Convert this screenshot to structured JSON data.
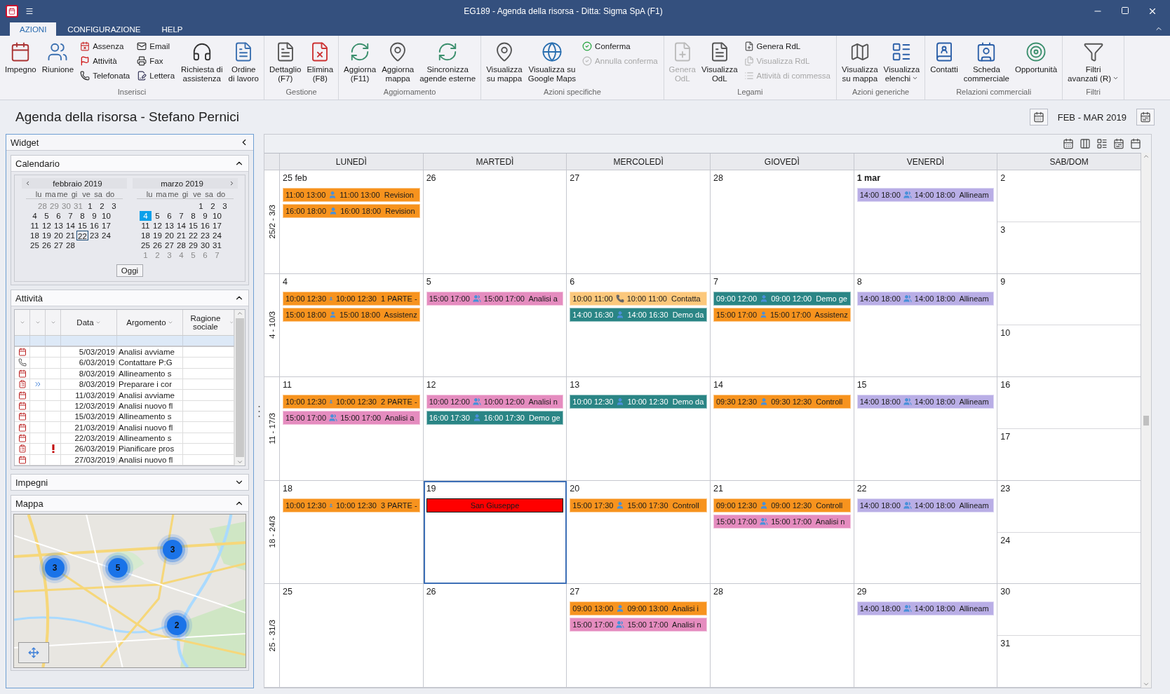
{
  "window": {
    "title": "EG189 - Agenda della risorsa - Ditta: Sigma SpA (F1)"
  },
  "tabs": [
    {
      "label": "AZIONI",
      "selected": true
    },
    {
      "label": "CONFIGURAZIONE",
      "selected": false
    },
    {
      "label": "HELP",
      "selected": false
    }
  ],
  "ribbon": [
    {
      "label": "Inserisci",
      "items": [
        {
          "kind": "large",
          "label": "Impegno",
          "disabled": false
        },
        {
          "kind": "large",
          "label": "Riunione",
          "disabled": false
        },
        {
          "kind": "small",
          "label": "Assenza",
          "disabled": false
        },
        {
          "kind": "small",
          "label": "Attività",
          "disabled": false
        },
        {
          "kind": "small",
          "label": "Telefonata",
          "disabled": false
        },
        {
          "kind": "small",
          "label": "Email",
          "disabled": false
        },
        {
          "kind": "small",
          "label": "Fax",
          "disabled": false
        },
        {
          "kind": "small",
          "label": "Lettera",
          "disabled": false
        },
        {
          "kind": "large",
          "label": "Richiesta di\nassistenza",
          "disabled": false
        },
        {
          "kind": "large",
          "label": "Ordine\ndi lavoro",
          "disabled": false
        }
      ]
    },
    {
      "label": "Gestione",
      "items": [
        {
          "kind": "large",
          "label": "Dettaglio\n(F7)",
          "disabled": false
        },
        {
          "kind": "large",
          "label": "Elimina\n(F8)",
          "disabled": false
        }
      ]
    },
    {
      "label": "Aggiornamento",
      "items": [
        {
          "kind": "large",
          "label": "Aggiorna\n(F11)",
          "disabled": false
        },
        {
          "kind": "large",
          "label": "Aggiorna\nmappa",
          "disabled": false
        },
        {
          "kind": "large",
          "label": "Sincronizza\nagende esterne",
          "disabled": false
        }
      ]
    },
    {
      "label": "Azioni specifiche",
      "items": [
        {
          "kind": "large",
          "label": "Visualizza\nsu mappa",
          "disabled": false
        },
        {
          "kind": "large",
          "label": "Visualizza su\nGoogle Maps",
          "disabled": false
        },
        {
          "kind": "small",
          "label": "Conferma",
          "disabled": false
        },
        {
          "kind": "small",
          "label": "Annulla conferma",
          "disabled": true
        }
      ]
    },
    {
      "label": "Legami",
      "items": [
        {
          "kind": "large",
          "label": "Genera\nOdL",
          "disabled": true
        },
        {
          "kind": "large",
          "label": "Visualizza\nOdL",
          "disabled": false
        },
        {
          "kind": "small",
          "label": "Genera RdL",
          "disabled": false
        },
        {
          "kind": "small",
          "label": "Visualizza RdL",
          "disabled": true
        },
        {
          "kind": "small",
          "label": "Attività di commessa",
          "disabled": true
        }
      ]
    },
    {
      "label": "Azioni generiche",
      "items": [
        {
          "kind": "large",
          "label": "Visualizza\nsu mappa",
          "disabled": false
        },
        {
          "kind": "dropdown",
          "label": "Visualizza\nelenchi",
          "disabled": false
        }
      ]
    },
    {
      "label": "Relazioni commerciali",
      "items": [
        {
          "kind": "large",
          "label": "Contatti",
          "disabled": false
        },
        {
          "kind": "large",
          "label": "Scheda\ncommerciale",
          "disabled": false
        },
        {
          "kind": "large",
          "label": "Opportunità",
          "disabled": false
        }
      ]
    },
    {
      "label": "Filtri",
      "items": [
        {
          "kind": "dropdown",
          "label": "Filtri\navanzati (R)",
          "disabled": false
        }
      ]
    }
  ],
  "page_title": "Agenda della risorsa - Stefano Pernici",
  "period": "FEB - MAR 2019",
  "widget": {
    "title": "Widget",
    "calendar": {
      "title": "Calendario",
      "expanded": true,
      "today_button": "Oggi",
      "months": [
        {
          "title": "febbraio 2019",
          "weekdays": [
            "lu",
            "ma",
            "me",
            "gi",
            "ve",
            "sa",
            "do"
          ],
          "weeks": [
            [
              {
                "d": "28",
                "muted": true,
                "selected": false,
                "today": false
              },
              {
                "d": "29",
                "muted": true,
                "selected": false,
                "today": false
              },
              {
                "d": "30",
                "muted": true,
                "selected": false,
                "today": false
              },
              {
                "d": "31",
                "muted": true,
                "selected": false,
                "today": false
              },
              {
                "d": "1",
                "muted": false,
                "selected": false,
                "today": false
              },
              {
                "d": "2",
                "muted": false,
                "selected": false,
                "today": false
              },
              {
                "d": "3",
                "muted": false,
                "selected": false,
                "today": false
              }
            ],
            [
              {
                "d": "4",
                "muted": false,
                "selected": false,
                "today": false
              },
              {
                "d": "5",
                "muted": false,
                "selected": false,
                "today": false
              },
              {
                "d": "6",
                "muted": false,
                "selected": false,
                "today": false
              },
              {
                "d": "7",
                "muted": false,
                "selected": false,
                "today": false
              },
              {
                "d": "8",
                "muted": false,
                "selected": false,
                "today": false
              },
              {
                "d": "9",
                "muted": false,
                "selected": false,
                "today": false
              },
              {
                "d": "10",
                "muted": false,
                "selected": false,
                "today": false
              }
            ],
            [
              {
                "d": "11",
                "muted": false,
                "selected": false,
                "today": false
              },
              {
                "d": "12",
                "muted": false,
                "selected": false,
                "today": false
              },
              {
                "d": "13",
                "muted": false,
                "selected": false,
                "today": false
              },
              {
                "d": "14",
                "muted": false,
                "selected": false,
                "today": false
              },
              {
                "d": "15",
                "muted": false,
                "selected": false,
                "today": false
              },
              {
                "d": "16",
                "muted": false,
                "selected": false,
                "today": false
              },
              {
                "d": "17",
                "muted": false,
                "selected": false,
                "today": false
              }
            ],
            [
              {
                "d": "18",
                "muted": false,
                "selected": false,
                "today": false
              },
              {
                "d": "19",
                "muted": false,
                "selected": false,
                "today": false
              },
              {
                "d": "20",
                "muted": false,
                "selected": false,
                "today": false
              },
              {
                "d": "21",
                "muted": false,
                "selected": false,
                "today": false
              },
              {
                "d": "22",
                "muted": false,
                "selected": false,
                "today": true
              },
              {
                "d": "23",
                "muted": false,
                "selected": false,
                "today": false
              },
              {
                "d": "24",
                "muted": false,
                "selected": false,
                "today": false
              }
            ],
            [
              {
                "d": "25",
                "muted": false,
                "selected": false,
                "today": false
              },
              {
                "d": "26",
                "muted": false,
                "selected": false,
                "today": false
              },
              {
                "d": "27",
                "muted": false,
                "selected": false,
                "today": false
              },
              {
                "d": "28",
                "muted": false,
                "selected": false,
                "today": false
              }
            ]
          ]
        },
        {
          "title": "marzo 2019",
          "weekdays": [
            "lu",
            "ma",
            "me",
            "gi",
            "ve",
            "sa",
            "do"
          ],
          "weeks": [
            [
              {
                "d": "1",
                "muted": false,
                "selected": false,
                "today": false
              },
              {
                "d": "2",
                "muted": false,
                "selected": false,
                "today": false
              },
              {
                "d": "3",
                "muted": false,
                "selected": false,
                "today": false
              }
            ],
            [
              {
                "d": "4",
                "muted": false,
                "selected": true,
                "today": false
              },
              {
                "d": "5",
                "muted": false,
                "selected": false,
                "today": false
              },
              {
                "d": "6",
                "muted": false,
                "selected": false,
                "today": false
              },
              {
                "d": "7",
                "muted": false,
                "selected": false,
                "today": false
              },
              {
                "d": "8",
                "muted": false,
                "selected": false,
                "today": false
              },
              {
                "d": "9",
                "muted": false,
                "selected": false,
                "today": false
              },
              {
                "d": "10",
                "muted": false,
                "selected": false,
                "today": false
              }
            ],
            [
              {
                "d": "11",
                "muted": false,
                "selected": false,
                "today": false
              },
              {
                "d": "12",
                "muted": false,
                "selected": false,
                "today": false
              },
              {
                "d": "13",
                "muted": false,
                "selected": false,
                "today": false
              },
              {
                "d": "14",
                "muted": false,
                "selected": false,
                "today": false
              },
              {
                "d": "15",
                "muted": false,
                "selected": false,
                "today": false
              },
              {
                "d": "16",
                "muted": false,
                "selected": false,
                "today": false
              },
              {
                "d": "17",
                "muted": false,
                "selected": false,
                "today": false
              }
            ],
            [
              {
                "d": "18",
                "muted": false,
                "selected": false,
                "today": false
              },
              {
                "d": "19",
                "muted": false,
                "selected": false,
                "today": false
              },
              {
                "d": "20",
                "muted": false,
                "selected": false,
                "today": false
              },
              {
                "d": "21",
                "muted": false,
                "selected": false,
                "today": false
              },
              {
                "d": "22",
                "muted": false,
                "selected": false,
                "today": false
              },
              {
                "d": "23",
                "muted": false,
                "selected": false,
                "today": false
              },
              {
                "d": "24",
                "muted": false,
                "selected": false,
                "today": false
              }
            ],
            [
              {
                "d": "25",
                "muted": false,
                "selected": false,
                "today": false
              },
              {
                "d": "26",
                "muted": false,
                "selected": false,
                "today": false
              },
              {
                "d": "27",
                "muted": false,
                "selected": false,
                "today": false
              },
              {
                "d": "28",
                "muted": false,
                "selected": false,
                "today": false
              },
              {
                "d": "29",
                "muted": false,
                "selected": false,
                "today": false
              },
              {
                "d": "30",
                "muted": false,
                "selected": false,
                "today": false
              },
              {
                "d": "31",
                "muted": false,
                "selected": false,
                "today": false
              }
            ],
            [
              {
                "d": "1",
                "muted": true,
                "selected": false,
                "today": false
              },
              {
                "d": "2",
                "muted": true,
                "selected": false,
                "today": false
              },
              {
                "d": "3",
                "muted": true,
                "selected": false,
                "today": false
              },
              {
                "d": "4",
                "muted": true,
                "selected": false,
                "today": false
              },
              {
                "d": "5",
                "muted": true,
                "selected": false,
                "today": false
              },
              {
                "d": "6",
                "muted": true,
                "selected": false,
                "today": false
              },
              {
                "d": "7",
                "muted": true,
                "selected": false,
                "today": false
              }
            ]
          ]
        }
      ]
    },
    "activities": {
      "title": "Attività",
      "expanded": true,
      "columns": [
        "Data",
        "Argomento",
        "Ragione sociale"
      ],
      "rows": [
        {
          "kind": "appointment",
          "forward": false,
          "urgent": false,
          "date": "5/03/2019",
          "subject": "Analisi avviame"
        },
        {
          "kind": "call",
          "forward": false,
          "urgent": false,
          "date": "6/03/2019",
          "subject": "Contattare P:G"
        },
        {
          "kind": "appointment",
          "forward": false,
          "urgent": false,
          "date": "8/03/2019",
          "subject": "Allineamento s"
        },
        {
          "kind": "task",
          "forward": true,
          "urgent": false,
          "date": "8/03/2019",
          "subject": "Preparare i cor"
        },
        {
          "kind": "appointment",
          "forward": false,
          "urgent": false,
          "date": "11/03/2019",
          "subject": "Analisi avviame"
        },
        {
          "kind": "appointment",
          "forward": false,
          "urgent": false,
          "date": "12/03/2019",
          "subject": "Analisi nuovo fl"
        },
        {
          "kind": "appointment",
          "forward": false,
          "urgent": false,
          "date": "15/03/2019",
          "subject": "Allineamento s"
        },
        {
          "kind": "appointment",
          "forward": false,
          "urgent": false,
          "date": "21/03/2019",
          "subject": "Analisi nuovo fl"
        },
        {
          "kind": "appointment",
          "forward": false,
          "urgent": false,
          "date": "22/03/2019",
          "subject": "Allineamento s"
        },
        {
          "kind": "task",
          "forward": false,
          "urgent": true,
          "date": "26/03/2019",
          "subject": "Pianificare pros"
        },
        {
          "kind": "appointment",
          "forward": false,
          "urgent": false,
          "date": "27/03/2019",
          "subject": "Analisi nuovo fl"
        }
      ]
    },
    "commitments": {
      "title": "Impegni",
      "expanded": false
    },
    "map": {
      "title": "Mappa",
      "expanded": true,
      "markers": [
        "3",
        "5",
        "3",
        "2"
      ]
    }
  },
  "columns": [
    "LUNEDÌ",
    "MARTEDÌ",
    "MERCOLEDÌ",
    "GIOVEDÌ",
    "VENERDÌ",
    "SAB/DOM"
  ],
  "weeks": [
    {
      "label": "25/2 - 3/3",
      "days": [
        {
          "date": "25 feb",
          "bold": false,
          "selected": false,
          "events": [
            {
              "kind": "single",
              "color": "#f7931e",
              "time": "11:00 13:00",
              "detail": "11:00 13:00  Revision"
            },
            {
              "kind": "single",
              "color": "#f7931e",
              "time": "16:00 18:00",
              "detail": "16:00 18:00  Revision"
            }
          ]
        },
        {
          "date": "26",
          "bold": false,
          "selected": false
        },
        {
          "date": "27",
          "bold": false,
          "selected": false
        },
        {
          "date": "28",
          "bold": false,
          "selected": false
        },
        {
          "date": "1 mar",
          "bold": true,
          "selected": false,
          "events": [
            {
              "kind": "group",
              "color": "#b9aee6",
              "time": "14:00 18:00",
              "detail": "14:00 18:00  Allineam"
            }
          ]
        },
        {
          "date": "2",
          "bold": false,
          "selected": false
        },
        {
          "date": "3",
          "bold": false,
          "selected": false
        }
      ]
    },
    {
      "label": "4 - 10/3",
      "days": [
        {
          "date": "4",
          "bold": false,
          "selected": false,
          "events": [
            {
              "kind": "single",
              "color": "#f7931e",
              "time": "10:00 12:30",
              "detail": "10:00 12:30  1 PARTE -"
            },
            {
              "kind": "single",
              "color": "#f7931e",
              "time": "15:00 18:00",
              "detail": "15:00 18:00  Assistenz"
            }
          ]
        },
        {
          "date": "5",
          "bold": false,
          "selected": false,
          "events": [
            {
              "kind": "group",
              "color": "#e58cbf",
              "time": "15:00 17:00",
              "detail": "15:00 17:00  Analisi a"
            }
          ]
        },
        {
          "date": "6",
          "bold": false,
          "selected": false,
          "events": [
            {
              "kind": "call",
              "color": "#fcc87c",
              "time": "10:00 11:00",
              "detail": "10:00 11:00  Contatta"
            },
            {
              "kind": "single",
              "color": "#2a8585",
              "time": "14:00 16:30",
              "detail": "14:00 16:30  Demo da"
            }
          ]
        },
        {
          "date": "7",
          "bold": false,
          "selected": false,
          "events": [
            {
              "kind": "single",
              "color": "#2a8585",
              "time": "09:00 12:00",
              "detail": "09:00 12:00  Demo ge"
            },
            {
              "kind": "single",
              "color": "#f7931e",
              "time": "15:00 17:00",
              "detail": "15:00 17:00  Assistenz"
            }
          ]
        },
        {
          "date": "8",
          "bold": false,
          "selected": false,
          "events": [
            {
              "kind": "group",
              "color": "#b9aee6",
              "time": "14:00 18:00",
              "detail": "14:00 18:00  Allineam"
            }
          ]
        },
        {
          "date": "9",
          "bold": false,
          "selected": false
        },
        {
          "date": "10",
          "bold": false,
          "selected": false
        }
      ]
    },
    {
      "label": "11 - 17/3",
      "days": [
        {
          "date": "11",
          "bold": false,
          "selected": false,
          "events": [
            {
              "kind": "single",
              "color": "#f7931e",
              "time": "10:00 12:30",
              "detail": "10:00 12:30  2 PARTE -"
            },
            {
              "kind": "group",
              "color": "#e58cbf",
              "time": "15:00 17:00",
              "detail": "15:00 17:00  Analisi a"
            }
          ]
        },
        {
          "date": "12",
          "bold": false,
          "selected": false,
          "events": [
            {
              "kind": "group",
              "color": "#e58cbf",
              "time": "10:00 12:00",
              "detail": "10:00 12:00  Analisi n"
            },
            {
              "kind": "single",
              "color": "#2a8585",
              "time": "16:00 17:30",
              "detail": "16:00 17:30  Demo ge"
            }
          ]
        },
        {
          "date": "13",
          "bold": false,
          "selected": false,
          "events": [
            {
              "kind": "single",
              "color": "#2a8585",
              "time": "10:00 12:30",
              "detail": "10:00 12:30  Demo da"
            }
          ]
        },
        {
          "date": "14",
          "bold": false,
          "selected": false,
          "events": [
            {
              "kind": "single",
              "color": "#f7931e",
              "time": "09:30 12:30",
              "detail": "09:30 12:30  Controll"
            }
          ]
        },
        {
          "date": "15",
          "bold": false,
          "selected": false,
          "events": [
            {
              "kind": "group",
              "color": "#b9aee6",
              "time": "14:00 18:00",
              "detail": "14:00 18:00  Allineam"
            }
          ]
        },
        {
          "date": "16",
          "bold": false,
          "selected": false
        },
        {
          "date": "17",
          "bold": false,
          "selected": false
        }
      ]
    },
    {
      "label": "18 - 24/3",
      "days": [
        {
          "date": "18",
          "bold": false,
          "selected": false,
          "events": [
            {
              "kind": "single",
              "color": "#f7931e",
              "time": "10:00 12:30",
              "detail": "10:00 12:30  3 PARTE -"
            }
          ]
        },
        {
          "date": "19",
          "bold": false,
          "selected": true,
          "events": [
            {
              "kind": "holiday",
              "color": "#ff0000",
              "title": "San Giuseppe"
            }
          ]
        },
        {
          "date": "20",
          "bold": false,
          "selected": false,
          "events": [
            {
              "kind": "single",
              "color": "#f7931e",
              "time": "15:00 17:30",
              "detail": "15:00 17:30  Controll"
            }
          ]
        },
        {
          "date": "21",
          "bold": false,
          "selected": false,
          "events": [
            {
              "kind": "single",
              "color": "#f7931e",
              "time": "09:00 12:30",
              "detail": "09:00 12:30  Controll"
            },
            {
              "kind": "group",
              "color": "#e58cbf",
              "time": "15:00 17:00",
              "detail": "15:00 17:00  Analisi n"
            }
          ]
        },
        {
          "date": "22",
          "bold": false,
          "selected": false,
          "events": [
            {
              "kind": "group",
              "color": "#b9aee6",
              "time": "14:00 18:00",
              "detail": "14:00 18:00  Allineam"
            }
          ]
        },
        {
          "date": "23",
          "bold": false,
          "selected": false
        },
        {
          "date": "24",
          "bold": false,
          "selected": false
        }
      ]
    },
    {
      "label": "25 - 31/3",
      "days": [
        {
          "date": "25",
          "bold": false,
          "selected": false
        },
        {
          "date": "26",
          "bold": false,
          "selected": false
        },
        {
          "date": "27",
          "bold": false,
          "selected": false,
          "events": [
            {
              "kind": "single",
              "color": "#f7931e",
              "time": "09:00 13:00",
              "detail": "09:00 13:00  Analisi i"
            },
            {
              "kind": "group",
              "color": "#e58cbf",
              "time": "15:00 17:00",
              "detail": "15:00 17:00  Analisi n"
            }
          ]
        },
        {
          "date": "28",
          "bold": false,
          "selected": false
        },
        {
          "date": "29",
          "bold": false,
          "selected": false,
          "events": [
            {
              "kind": "group",
              "color": "#b9aee6",
              "time": "14:00 18:00",
              "detail": "14:00 18:00  Allineam"
            }
          ]
        },
        {
          "date": "30",
          "bold": false,
          "selected": false
        },
        {
          "date": "31",
          "bold": false,
          "selected": false
        }
      ]
    }
  ]
}
